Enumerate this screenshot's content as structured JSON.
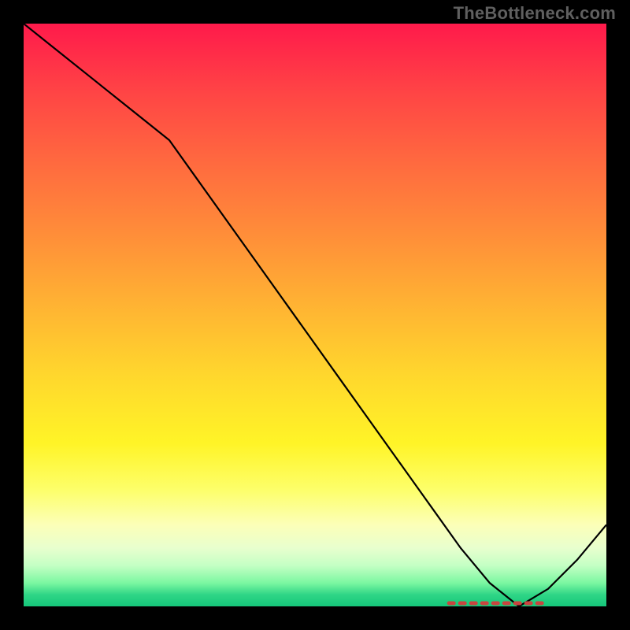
{
  "watermark": "TheBottleneck.com",
  "chart_data": {
    "type": "line",
    "title": "",
    "xlabel": "",
    "ylabel": "",
    "xlim": [
      0,
      100
    ],
    "ylim": [
      0,
      100
    ],
    "grid": false,
    "series": [
      {
        "name": "bottleneck-curve",
        "x": [
          0,
          5,
          10,
          15,
          20,
          25,
          30,
          35,
          40,
          45,
          50,
          55,
          60,
          65,
          70,
          75,
          80,
          85,
          90,
          95,
          100
        ],
        "y": [
          100,
          96,
          92,
          88,
          84,
          80,
          73,
          66,
          59,
          52,
          45,
          38,
          31,
          24,
          17,
          10,
          4,
          0,
          3,
          8,
          14
        ]
      }
    ],
    "annotations": [
      {
        "name": "optimal-range-marker",
        "x_start": 73,
        "x_end": 89,
        "y": 0
      }
    ],
    "background_gradient": {
      "orientation": "vertical",
      "stops": [
        {
          "pos": 0.0,
          "color": "#ff1a4b"
        },
        {
          "pos": 0.5,
          "color": "#ffb233"
        },
        {
          "pos": 0.8,
          "color": "#fdff6a"
        },
        {
          "pos": 1.0,
          "color": "#15c77a"
        }
      ]
    }
  }
}
